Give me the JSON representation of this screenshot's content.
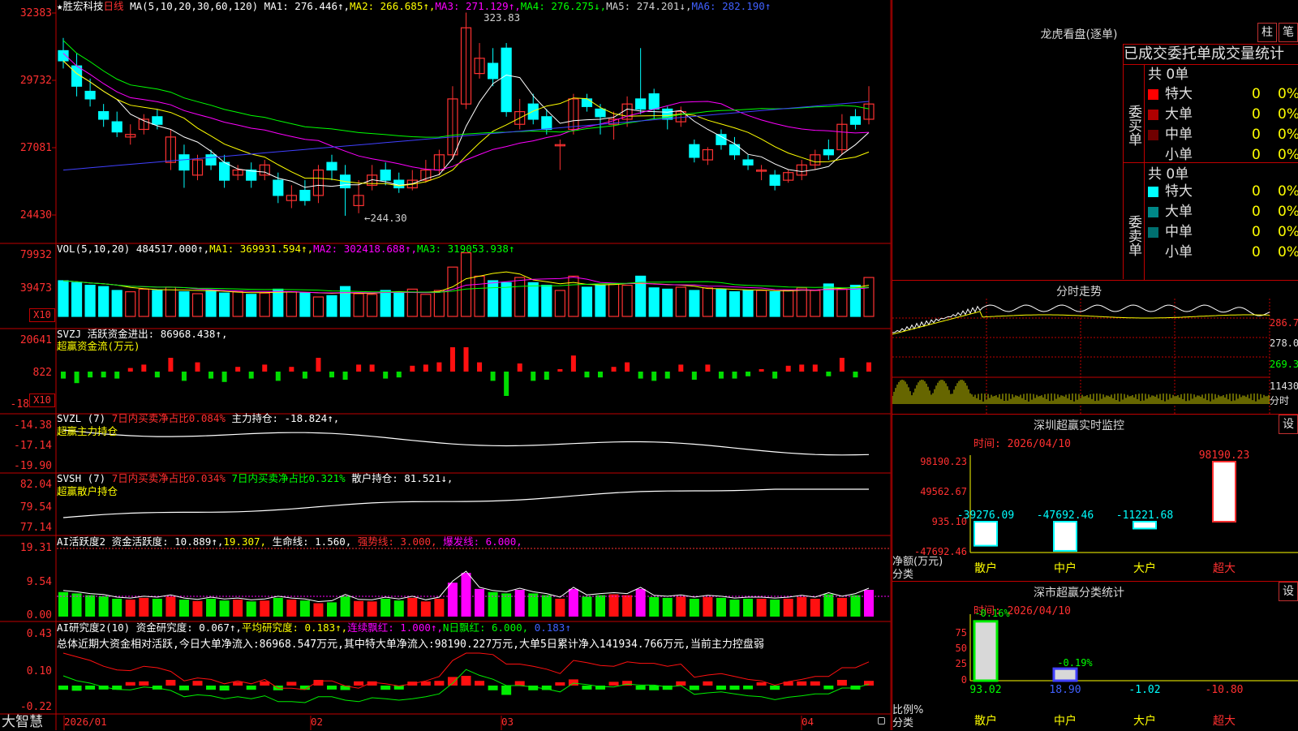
{
  "stock": {
    "star": "★",
    "name": "胜宏科技",
    "period": "日线",
    "ma_params": "MA(5,10,20,30,60,120)",
    "ma1": "MA1: 276.446↑,",
    "ma2": "MA2: 266.685↑,",
    "ma3": "MA3: 271.129↑,",
    "ma4": "MA4: 276.275↓,",
    "ma5": "MA5: 274.201↓,",
    "ma6": "MA6: 282.190↑",
    "high_mark": "323.83",
    "low_mark": "←244.30"
  },
  "price_axis": [
    "32383",
    "29732",
    "27081",
    "24430"
  ],
  "volume": {
    "label": "VOL(5,10,20)",
    "value": "484517.000↑,",
    "ma1": "MA1: 369931.594↑,",
    "ma2": "MA2: 302418.688↑,",
    "ma3": "MA3: 319053.938↑",
    "axis": [
      "79932",
      "39473"
    ],
    "unit": "X10"
  },
  "svzj": {
    "label": "SVZJ",
    "desc": "活跃资金进出: 86968.438↑,",
    "title": "超赢资金流(万元)",
    "axis": [
      "20641",
      "822",
      "-18"
    ],
    "unit": "X10"
  },
  "svzl": {
    "label": "SVZL (7)",
    "desc1": "7日内买卖净占比0.084%",
    "desc2": "主力持仓: -18.824↑,",
    "title": "超赢主力持仓",
    "axis": [
      "-14.38",
      "-17.14",
      "-19.90"
    ]
  },
  "svsh": {
    "label": "SVSH (7)",
    "desc1": "7日内买卖净占比0.034%",
    "desc2": "7日内买卖净占比0.321%",
    "desc3": "散户持仓: 81.521↓,",
    "title": "超赢散户持仓",
    "axis": [
      "82.04",
      "79.54",
      "77.14"
    ]
  },
  "ai_active": {
    "label": "AI活跃度2",
    "desc1": "资金活跃度: 10.889↑,",
    "desc2": "19.307,",
    "desc3": "生命线: 1.560,",
    "desc4": "强势线: 3.000,",
    "desc5": "爆发线: 6.000,",
    "axis": [
      "19.31",
      "9.54",
      "0.00"
    ]
  },
  "ai_research": {
    "label": "AI研究度2(10)",
    "desc1": "资金研究度: 0.067↑,",
    "desc2": "平均研究度: 0.183↑,",
    "desc3": "连续飘红: 1.000↑,",
    "desc4": "N日飘红: 6.000,",
    "desc5": "0.183↑",
    "summary": "总体近期大资金相对活跃,今日大单净流入:86968.547万元,其中特大单净流入:98190.227万元,大单5日累计净入141934.766万元,当前主力控盘弱",
    "axis": [
      "0.43",
      "0.10",
      "-0.22"
    ]
  },
  "date_axis": [
    "2026/01",
    "02",
    "03",
    "04"
  ],
  "brand": "大智慧",
  "dragon_tiger": {
    "title": "龙虎看盘(逐单)",
    "btn_bar": "柱",
    "btn_pen": "笔",
    "subtitle": "已成交委托单成交量统计",
    "buy_total": "共 0单",
    "sell_total": "共 0单",
    "buy_label": "委买单",
    "sell_label": "委卖单",
    "buy_rows": [
      {
        "name": "特大",
        "count": "0",
        "pct": "0%",
        "color": "#ff0000"
      },
      {
        "name": "大单",
        "count": "0",
        "pct": "0%",
        "color": "#b00000"
      },
      {
        "name": "中单",
        "count": "0",
        "pct": "0%",
        "color": "#700000"
      },
      {
        "name": "小单",
        "count": "0",
        "pct": "0%",
        "color": "#000000"
      }
    ],
    "sell_rows": [
      {
        "name": "特大",
        "count": "0",
        "pct": "0%",
        "color": "#00ffff"
      },
      {
        "name": "大单",
        "count": "0",
        "pct": "0%",
        "color": "#008888"
      },
      {
        "name": "中单",
        "count": "0",
        "pct": "0%",
        "color": "#007070"
      },
      {
        "name": "小单",
        "count": "0",
        "pct": "0%",
        "color": "#000000"
      }
    ]
  },
  "intraday": {
    "title": "分时走势",
    "axis": [
      "286.7",
      "278.0",
      "269.3",
      "11430",
      "分时"
    ]
  },
  "sz_monitor": {
    "title": "深圳超赢实时监控",
    "btn": "设",
    "time": "时间: 2026/04/10",
    "axis": [
      "98190.23",
      "49562.67",
      "935.10",
      "-47692.46"
    ],
    "ylabel1": "净额(万元)",
    "ylabel2": "分类",
    "categories": [
      "散户",
      "中户",
      "大户",
      "超大"
    ],
    "values": [
      "-39276.09",
      "-47692.46",
      "-11221.68",
      "98190.23"
    ]
  },
  "sz_classify": {
    "title": "深市超赢分类统计",
    "btn": "设",
    "time": "时间: 2026/04/10",
    "axis": [
      "75",
      "50",
      "25",
      "0"
    ],
    "ylabel1": "比例%",
    "ylabel2": "分类",
    "top_labels": [
      "-0.16%",
      "-0.19%"
    ],
    "categories": [
      "散户",
      "中户",
      "大户",
      "超大"
    ],
    "values": [
      "93.02",
      "18.90",
      "-1.02",
      "-10.80"
    ]
  },
  "colors": {
    "up": "#ff3232",
    "down": "#00ffff",
    "ma1": "#ffffff",
    "ma2": "#ffff00",
    "ma3": "#ff00ff",
    "ma4": "#00ff00",
    "ma5": "#c0c0c0",
    "ma6": "#4040ff",
    "border": "#c00000"
  },
  "chart_data": {
    "type": "candlestick",
    "title": "胜宏科技 日线",
    "ylim": [
      24430,
      32383
    ],
    "xlabels": [
      "2026/01",
      "02",
      "03",
      "04"
    ],
    "candles": [
      {
        "o": 309,
        "c": 305,
        "h": 314,
        "l": 302
      },
      {
        "o": 303,
        "c": 295,
        "h": 308,
        "l": 291
      },
      {
        "o": 293,
        "c": 290,
        "h": 298,
        "l": 287
      },
      {
        "o": 285,
        "c": 282,
        "h": 288,
        "l": 279
      },
      {
        "o": 281,
        "c": 277,
        "h": 285,
        "l": 275
      },
      {
        "o": 275,
        "c": 276,
        "h": 280,
        "l": 272
      },
      {
        "o": 278,
        "c": 282,
        "h": 284,
        "l": 276
      },
      {
        "o": 283,
        "c": 280,
        "h": 286,
        "l": 278
      },
      {
        "o": 265,
        "c": 275,
        "h": 278,
        "l": 262
      },
      {
        "o": 268,
        "c": 262,
        "h": 272,
        "l": 255
      },
      {
        "o": 260,
        "c": 266,
        "h": 268,
        "l": 258
      },
      {
        "o": 268,
        "c": 264,
        "h": 270,
        "l": 262
      },
      {
        "o": 265,
        "c": 258,
        "h": 268,
        "l": 255
      },
      {
        "o": 260,
        "c": 262,
        "h": 264,
        "l": 258
      },
      {
        "o": 262,
        "c": 258,
        "h": 265,
        "l": 255
      },
      {
        "o": 260,
        "c": 264,
        "h": 266,
        "l": 258
      },
      {
        "o": 258,
        "c": 252,
        "h": 261,
        "l": 249
      },
      {
        "o": 250,
        "c": 252,
        "h": 256,
        "l": 247
      },
      {
        "o": 254,
        "c": 250,
        "h": 258,
        "l": 248
      },
      {
        "o": 252,
        "c": 262,
        "h": 264,
        "l": 249
      },
      {
        "o": 265,
        "c": 262,
        "h": 268,
        "l": 258
      },
      {
        "o": 260,
        "c": 255,
        "h": 264,
        "l": 244
      },
      {
        "o": 248,
        "c": 252,
        "h": 258,
        "l": 245
      },
      {
        "o": 256,
        "c": 260,
        "h": 264,
        "l": 254
      },
      {
        "o": 262,
        "c": 258,
        "h": 265,
        "l": 256
      },
      {
        "o": 258,
        "c": 255,
        "h": 261,
        "l": 253
      },
      {
        "o": 255,
        "c": 258,
        "h": 262,
        "l": 254
      },
      {
        "o": 258,
        "c": 262,
        "h": 266,
        "l": 257
      },
      {
        "o": 262,
        "c": 268,
        "h": 270,
        "l": 260
      },
      {
        "o": 268,
        "c": 290,
        "h": 295,
        "l": 266
      },
      {
        "o": 288,
        "c": 318,
        "h": 324,
        "l": 286
      },
      {
        "o": 300,
        "c": 306,
        "h": 312,
        "l": 298
      },
      {
        "o": 304,
        "c": 298,
        "h": 310,
        "l": 295
      },
      {
        "o": 310,
        "c": 285,
        "h": 312,
        "l": 283
      },
      {
        "o": 280,
        "c": 285,
        "h": 290,
        "l": 278
      },
      {
        "o": 288,
        "c": 282,
        "h": 292,
        "l": 280
      },
      {
        "o": 283,
        "c": 278,
        "h": 286,
        "l": 276
      },
      {
        "o": 272,
        "c": 272,
        "h": 274,
        "l": 262
      },
      {
        "o": 278,
        "c": 290,
        "h": 292,
        "l": 276
      },
      {
        "o": 290,
        "c": 287,
        "h": 292,
        "l": 285
      },
      {
        "o": 286,
        "c": 283,
        "h": 288,
        "l": 276
      },
      {
        "o": 280,
        "c": 282,
        "h": 285,
        "l": 274
      },
      {
        "o": 282,
        "c": 288,
        "h": 291,
        "l": 279
      },
      {
        "o": 290,
        "c": 286,
        "h": 310,
        "l": 284
      },
      {
        "o": 292,
        "c": 286,
        "h": 294,
        "l": 282
      },
      {
        "o": 286,
        "c": 282,
        "h": 287,
        "l": 278
      },
      {
        "o": 281,
        "c": 285,
        "h": 287,
        "l": 279
      },
      {
        "o": 272,
        "c": 267,
        "h": 274,
        "l": 265
      },
      {
        "o": 266,
        "c": 270,
        "h": 271,
        "l": 264
      },
      {
        "o": 276,
        "c": 272,
        "h": 278,
        "l": 270
      },
      {
        "o": 272,
        "c": 268,
        "h": 275,
        "l": 266
      },
      {
        "o": 266,
        "c": 264,
        "h": 268,
        "l": 262
      },
      {
        "o": 262,
        "c": 262,
        "h": 264,
        "l": 258
      },
      {
        "o": 260,
        "c": 256,
        "h": 262,
        "l": 254
      },
      {
        "o": 258,
        "c": 261,
        "h": 262,
        "l": 257
      },
      {
        "o": 260,
        "c": 264,
        "h": 266,
        "l": 258
      },
      {
        "o": 264,
        "c": 268,
        "h": 270,
        "l": 262
      },
      {
        "o": 270,
        "c": 268,
        "h": 274,
        "l": 266
      },
      {
        "o": 270,
        "c": 280,
        "h": 284,
        "l": 268
      },
      {
        "o": 283,
        "c": 280,
        "h": 286,
        "l": 278
      },
      {
        "o": 282,
        "c": 288,
        "h": 295,
        "l": 280
      }
    ],
    "volume": [
      55,
      52,
      48,
      46,
      40,
      38,
      42,
      40,
      45,
      38,
      35,
      40,
      36,
      38,
      34,
      36,
      42,
      38,
      36,
      30,
      32,
      46,
      35,
      34,
      40,
      36,
      42,
      34,
      40,
      76,
      98,
      62,
      55,
      52,
      60,
      52,
      48,
      40,
      62,
      45,
      48,
      50,
      48,
      62,
      44,
      42,
      45,
      40,
      44,
      42,
      38,
      40,
      40,
      38,
      40,
      44,
      40,
      50,
      42,
      48,
      60
    ]
  }
}
